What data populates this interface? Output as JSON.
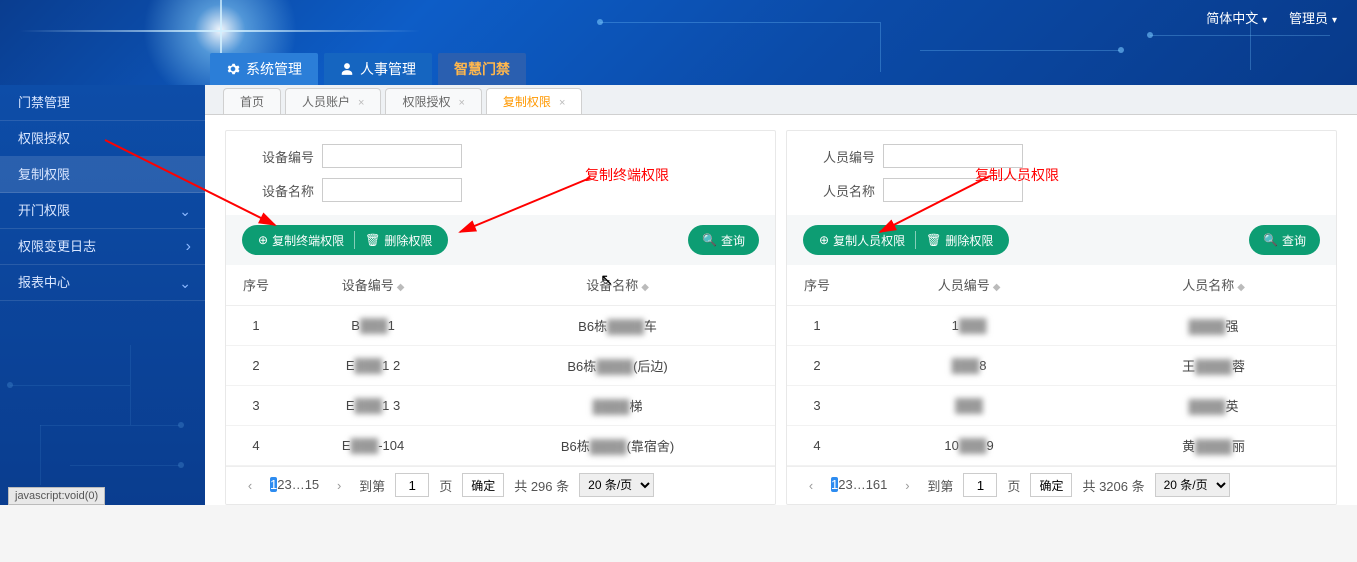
{
  "header": {
    "lang": "简体中文",
    "user": "管理员",
    "nav": {
      "system": "系统管理",
      "hr": "人事管理",
      "smart": "智慧门禁"
    }
  },
  "sidebar": {
    "items": [
      {
        "label": "门禁管理"
      },
      {
        "label": "权限授权"
      },
      {
        "label": "复制权限"
      },
      {
        "label": "开门权限"
      },
      {
        "label": "权限变更日志"
      },
      {
        "label": "报表中心"
      }
    ]
  },
  "tabs": {
    "home": "首页",
    "accounts": "人员账户",
    "auth": "权限授权",
    "copy": "复制权限"
  },
  "left_panel": {
    "filter1_label": "设备编号",
    "filter2_label": "设备名称",
    "btn_copy": "复制终端权限",
    "btn_delete": "删除权限",
    "btn_search": "查询",
    "headers": {
      "seq": "序号",
      "code": "设备编号",
      "name": "设备名称"
    },
    "rows": [
      {
        "seq": "1",
        "code_prefix": "B",
        "code_suffix": "1",
        "name_pre": "B6栋",
        "name_suf": "车"
      },
      {
        "seq": "2",
        "code_prefix": "E",
        "code_suffix": "1 2",
        "name_pre": "B6栋",
        "name_suf": "(后边)"
      },
      {
        "seq": "3",
        "code_prefix": "E",
        "code_suffix": "1 3",
        "name_pre": "",
        "name_suf": "梯"
      },
      {
        "seq": "4",
        "code_prefix": "E",
        "code_suffix": "-104",
        "name_pre": "B6栋",
        "name_suf": "(靠宿舍)"
      }
    ],
    "pager": {
      "pages": [
        "1",
        "2",
        "3",
        "…",
        "15"
      ],
      "goto_label": "到第",
      "page_unit": "页",
      "ok": "确定",
      "total": "共 296 条",
      "per": "20 条/页",
      "cur_goto": "1"
    }
  },
  "right_panel": {
    "filter1_label": "人员编号",
    "filter2_label": "人员名称",
    "btn_copy": "复制人员权限",
    "btn_delete": "删除权限",
    "btn_search": "查询",
    "headers": {
      "seq": "序号",
      "code": "人员编号",
      "name": "人员名称"
    },
    "rows": [
      {
        "seq": "1",
        "code_prefix": "1",
        "code_suffix": "",
        "name_pre": "",
        "name_suf": "强"
      },
      {
        "seq": "2",
        "code_prefix": "",
        "code_suffix": "8",
        "name_pre": "王",
        "name_suf": "蓉"
      },
      {
        "seq": "3",
        "code_prefix": "",
        "code_suffix": "",
        "name_pre": "",
        "name_suf": "英"
      },
      {
        "seq": "4",
        "code_prefix": "10",
        "code_suffix": "9",
        "name_pre": "黄",
        "name_suf": "丽"
      }
    ],
    "pager": {
      "pages": [
        "1",
        "2",
        "3",
        "…",
        "161"
      ],
      "goto_label": "到第",
      "page_unit": "页",
      "ok": "确定",
      "total": "共 3206 条",
      "per": "20 条/页",
      "cur_goto": "1"
    }
  },
  "annotations": {
    "left": "复制终端权限",
    "right": "复制人员权限"
  },
  "status": "javascript:void(0)"
}
